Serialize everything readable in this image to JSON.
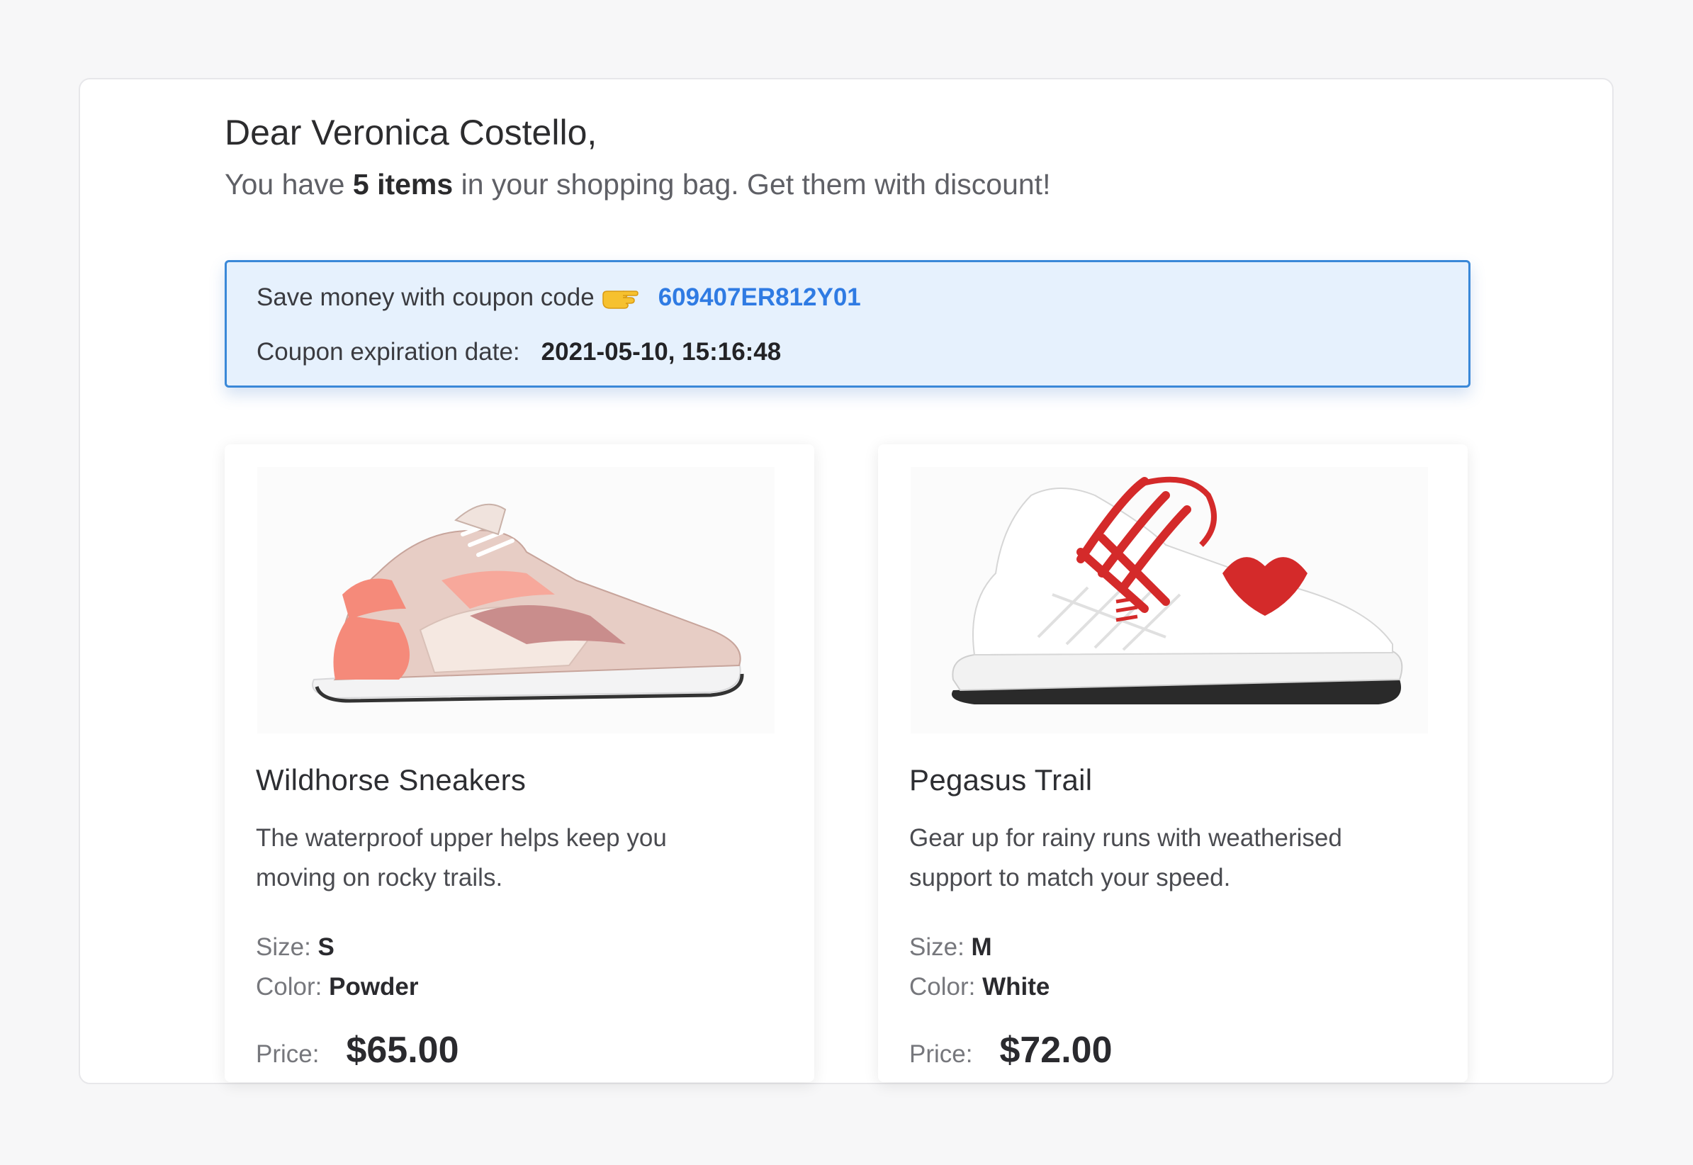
{
  "email": {
    "greeting": "Dear Veronica Costello,",
    "summary_prefix": "You have ",
    "summary_count": "5 items",
    "summary_suffix": " in your shopping bag. Get them with discount!"
  },
  "coupon": {
    "label": "Save money with coupon code",
    "hand_icon": "pointing-hand-icon",
    "code": "609407ER812Y01",
    "expiry_label": "Coupon expiration date:",
    "expiry_value": "2021-05-10, 15:16:48",
    "accent_color": "#2f7be3",
    "background_color": "#e6f1fd"
  },
  "products": [
    {
      "name": "Wildhorse Sneakers",
      "description": "The waterproof upper helps keep you moving on rocky trails.",
      "size_label": "Size:",
      "size_value": "S",
      "color_label": "Color:",
      "color_value": "Powder",
      "price_label": "Price:",
      "price_value": "$65.00",
      "image": "pink-sneaker-image"
    },
    {
      "name": "Pegasus Trail",
      "description": "Gear up for rainy runs with weatherised support to match your speed.",
      "size_label": "Size:",
      "size_value": "M",
      "color_label": "Color:",
      "color_value": "White",
      "price_label": "Price:",
      "price_value": "$72.00",
      "image": "white-red-sneaker-image"
    }
  ]
}
